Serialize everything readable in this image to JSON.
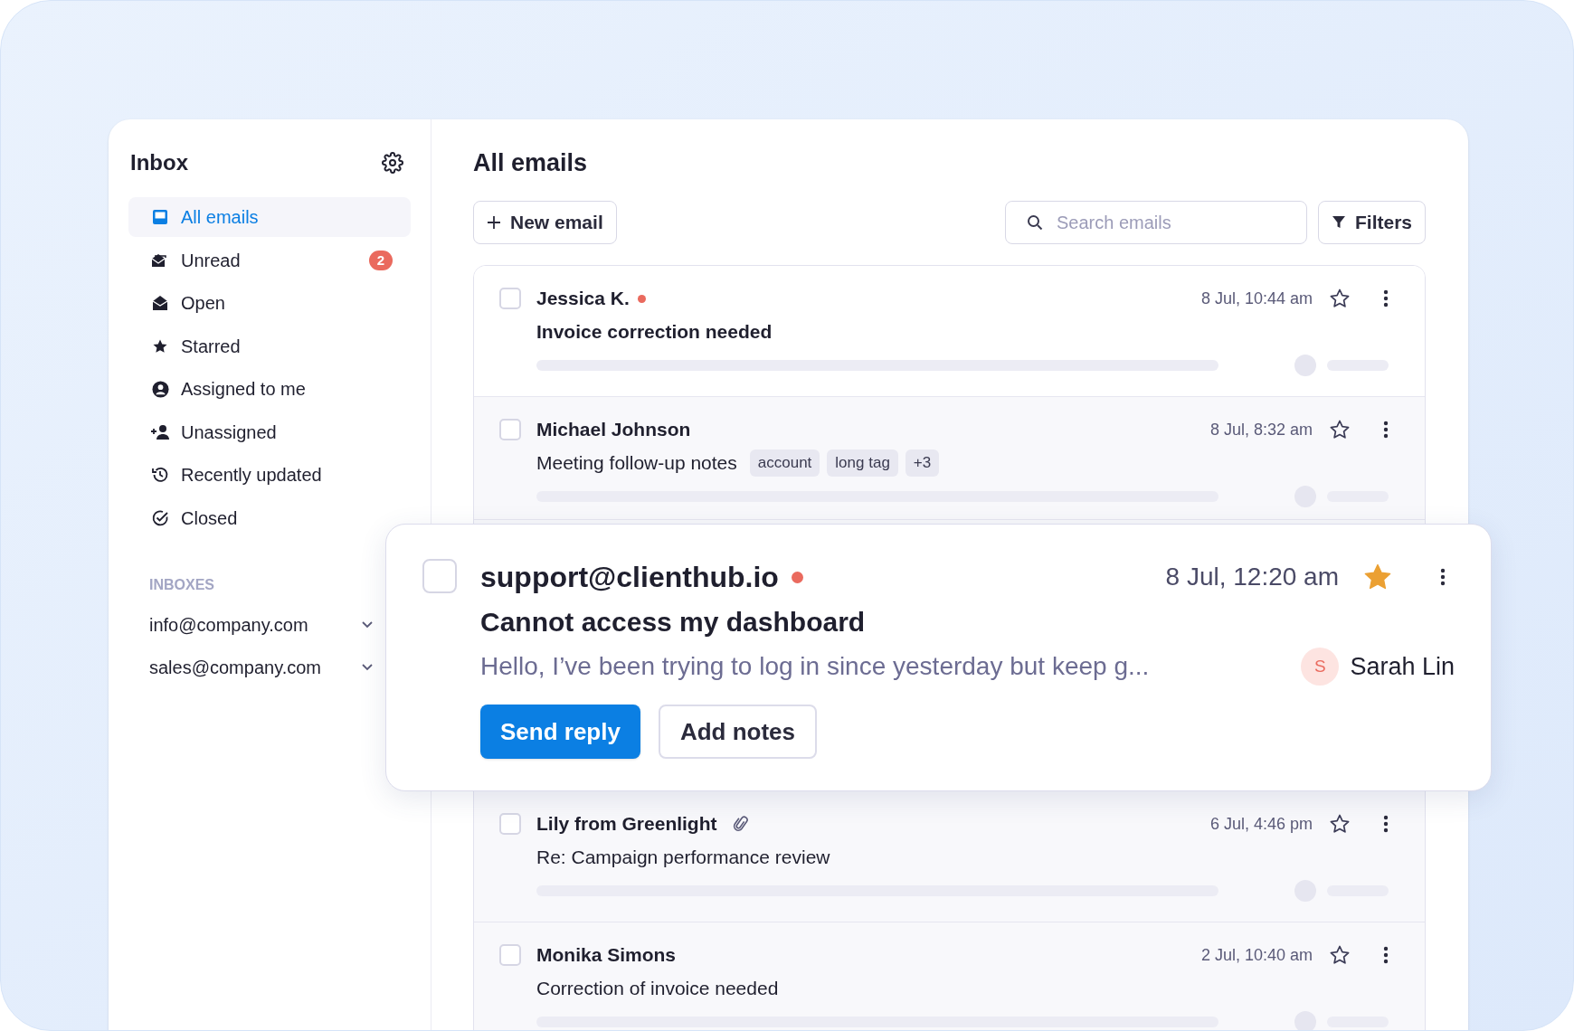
{
  "sidebar": {
    "title": "Inbox",
    "items": [
      {
        "label": "All emails",
        "selected": true
      },
      {
        "label": "Unread",
        "selected": false,
        "badge": "2"
      },
      {
        "label": "Open",
        "selected": false
      },
      {
        "label": "Starred",
        "selected": false
      },
      {
        "label": "Assigned to me",
        "selected": false
      },
      {
        "label": "Unassigned",
        "selected": false
      },
      {
        "label": "Recently updated",
        "selected": false
      },
      {
        "label": "Closed",
        "selected": false
      }
    ],
    "section_heading": "INBOXES",
    "inboxes": [
      {
        "label": "info@company.com"
      },
      {
        "label": "sales@company.com"
      }
    ]
  },
  "main": {
    "title": "All emails",
    "new_button": "New email",
    "search": {
      "placeholder": "Search emails"
    },
    "filters_button": "Filters"
  },
  "emails": [
    {
      "sender": "Jessica K.",
      "unread": true,
      "attachment": false,
      "date": "8 Jul, 10:44 am",
      "subject": "Invoice correction needed",
      "starred": false,
      "checked": false
    },
    {
      "sender": "Michael Johnson",
      "unread": false,
      "attachment": false,
      "date": "8 Jul, 8:32 am",
      "subject": "Meeting follow-up notes",
      "starred": false,
      "checked": false,
      "tags": [
        "account",
        "long tag",
        "+3"
      ]
    },
    {
      "sender": "Lily from Greenlight",
      "unread": false,
      "attachment": true,
      "date": "6 Jul, 4:46 pm",
      "subject": "Re: Campaign performance review",
      "starred": false,
      "checked": false
    },
    {
      "sender": "Monika Simons",
      "unread": false,
      "attachment": false,
      "date": "2 Jul, 10:40 am",
      "subject": "Correction of invoice needed",
      "starred": false,
      "checked": false
    }
  ],
  "expanded_email": {
    "sender": "support@clienthub.io",
    "unread": true,
    "date": "8 Jul, 12:20 am",
    "starred": true,
    "checked": false,
    "subject": "Cannot access my dashboard",
    "preview": "Hello, I’ve been trying to log in since yesterday but keep g...",
    "assignee": {
      "initial": "S",
      "name": "Sarah Lin"
    },
    "buttons": [
      "Send reply",
      "Add notes"
    ]
  }
}
